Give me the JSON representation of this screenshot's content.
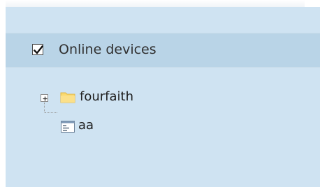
{
  "header": {
    "checked": true,
    "label": "Online devices"
  },
  "tree": {
    "nodes": [
      {
        "label": "fourfaith",
        "icon": "folder-icon",
        "expander": "plus"
      },
      {
        "label": "aa",
        "icon": "device-list-icon"
      }
    ]
  },
  "colors": {
    "panel_bg": "#cfe3f2",
    "header_bg": "#b9d4e7",
    "folder": "#f7d36b"
  }
}
